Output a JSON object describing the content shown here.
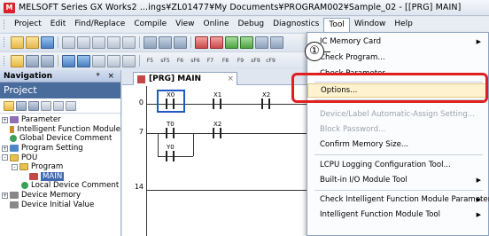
{
  "window": {
    "app_icon": "MELSOFT logo icon",
    "title": "MELSOFT Series GX Works2 ...ings¥ZL01477¥My Documents¥PROGRAM002¥Sample_02 - [[PRG] MAIN]"
  },
  "menubar": {
    "items": [
      "Project",
      "Edit",
      "Find/Replace",
      "Compile",
      "View",
      "Online",
      "Debug",
      "Diagnostics",
      "Tool",
      "Window",
      "Help"
    ],
    "active": "Tool"
  },
  "toolbar2": {
    "fkeys": [
      "F5",
      "sF5",
      "F6",
      "sF6",
      "F7",
      "F8",
      "F9",
      "sF9",
      "cF9"
    ]
  },
  "navigation": {
    "header": "Navigation",
    "pin_controls": "ᵠ ×",
    "title": "Project",
    "tree": [
      {
        "label": "Parameter",
        "expander": "+",
        "icon": "parameter-icon"
      },
      {
        "label": "Intelligent Function Module",
        "expander": "",
        "icon": "intelligent-module-icon"
      },
      {
        "label": "Global Device Comment",
        "expander": "",
        "icon": "global-comment-icon"
      },
      {
        "label": "Program Setting",
        "expander": "+",
        "icon": "program-setting-icon"
      },
      {
        "label": "POU",
        "expander": "-",
        "icon": "folder-icon"
      },
      {
        "label": "Program",
        "expander": "-",
        "icon": "folder-icon"
      },
      {
        "label": "MAIN",
        "expander": "",
        "icon": "program-main-icon"
      },
      {
        "label": "Local Device Comment",
        "expander": "",
        "icon": "local-comment-icon"
      },
      {
        "label": "Device Memory",
        "expander": "+",
        "icon": "device-memory-icon"
      },
      {
        "label": "Device Initial Value",
        "expander": "",
        "icon": "device-initial-icon"
      }
    ]
  },
  "editor": {
    "tab_label": "[PRG] MAIN",
    "tab_close": "×",
    "rung_numbers": [
      "0",
      "7",
      "14"
    ],
    "devices": [
      "X0",
      "X1",
      "X2",
      "T0",
      "X2",
      "Y0"
    ]
  },
  "tool_menu": {
    "items": [
      {
        "label": "IC Memory Card",
        "enabled": true,
        "submenu": true
      },
      {
        "label": "Check Program...",
        "enabled": true,
        "submenu": false
      },
      {
        "label": "Check Parameter...",
        "enabled": true,
        "submenu": false
      },
      {
        "label": "Options...",
        "enabled": true,
        "submenu": false,
        "highlighted": true
      },
      {
        "label": "Device/Label Automatic-Assign Setting...",
        "enabled": false,
        "submenu": false
      },
      {
        "label": "Block Password...",
        "enabled": false,
        "submenu": false
      },
      {
        "label": "Confirm Memory Size...",
        "enabled": true,
        "submenu": false
      },
      {
        "label": "LCPU Logging Configuration Tool...",
        "enabled": true,
        "submenu": false
      },
      {
        "label": "Built-in I/O Module Tool",
        "enabled": true,
        "submenu": true
      },
      {
        "label": "Check Intelligent Function Module Parameter",
        "enabled": true,
        "submenu": true
      },
      {
        "label": "Intelligent Function Module Tool",
        "enabled": true,
        "submenu": true
      }
    ]
  },
  "annotation": {
    "step_number": "①",
    "highlight_color": "#e0201e"
  }
}
